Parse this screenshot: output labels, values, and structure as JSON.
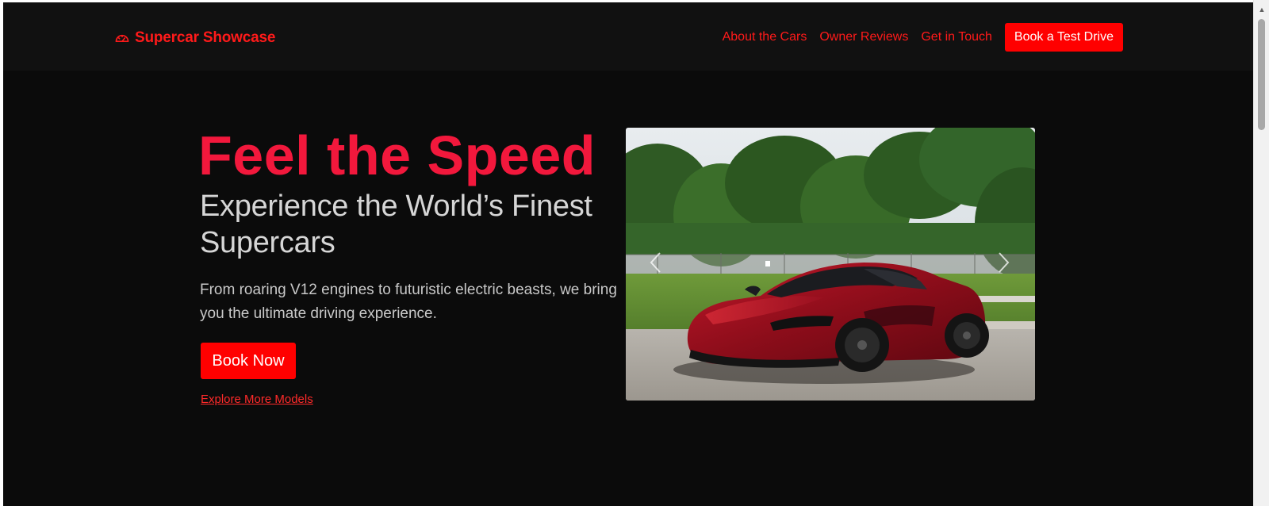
{
  "brand": {
    "icon": "speedometer-icon",
    "name": "Supercar Showcase",
    "color": "#ff1a1a"
  },
  "nav": {
    "links": [
      "About the Cars",
      "Owner Reviews",
      "Get in Touch"
    ],
    "cta": "Book a Test Drive"
  },
  "hero": {
    "title": "Feel the Speed",
    "subtitle": "Experience the World’s Finest Supercars",
    "description": "From roaring V12 engines to futuristic electric beasts, we bring you the ultimate driving experience.",
    "primary_button": "Book Now",
    "secondary_link": "Explore More Models"
  },
  "carousel": {
    "image": "red-supercar-photo",
    "prev_icon": "chevron-left-icon",
    "next_icon": "chevron-right-icon",
    "slide_count": 1,
    "active_slide": 1
  },
  "colors": {
    "accent": "#ff0000",
    "title": "#f2183c",
    "background": "#0b0b0b",
    "navbar": "#111111"
  }
}
